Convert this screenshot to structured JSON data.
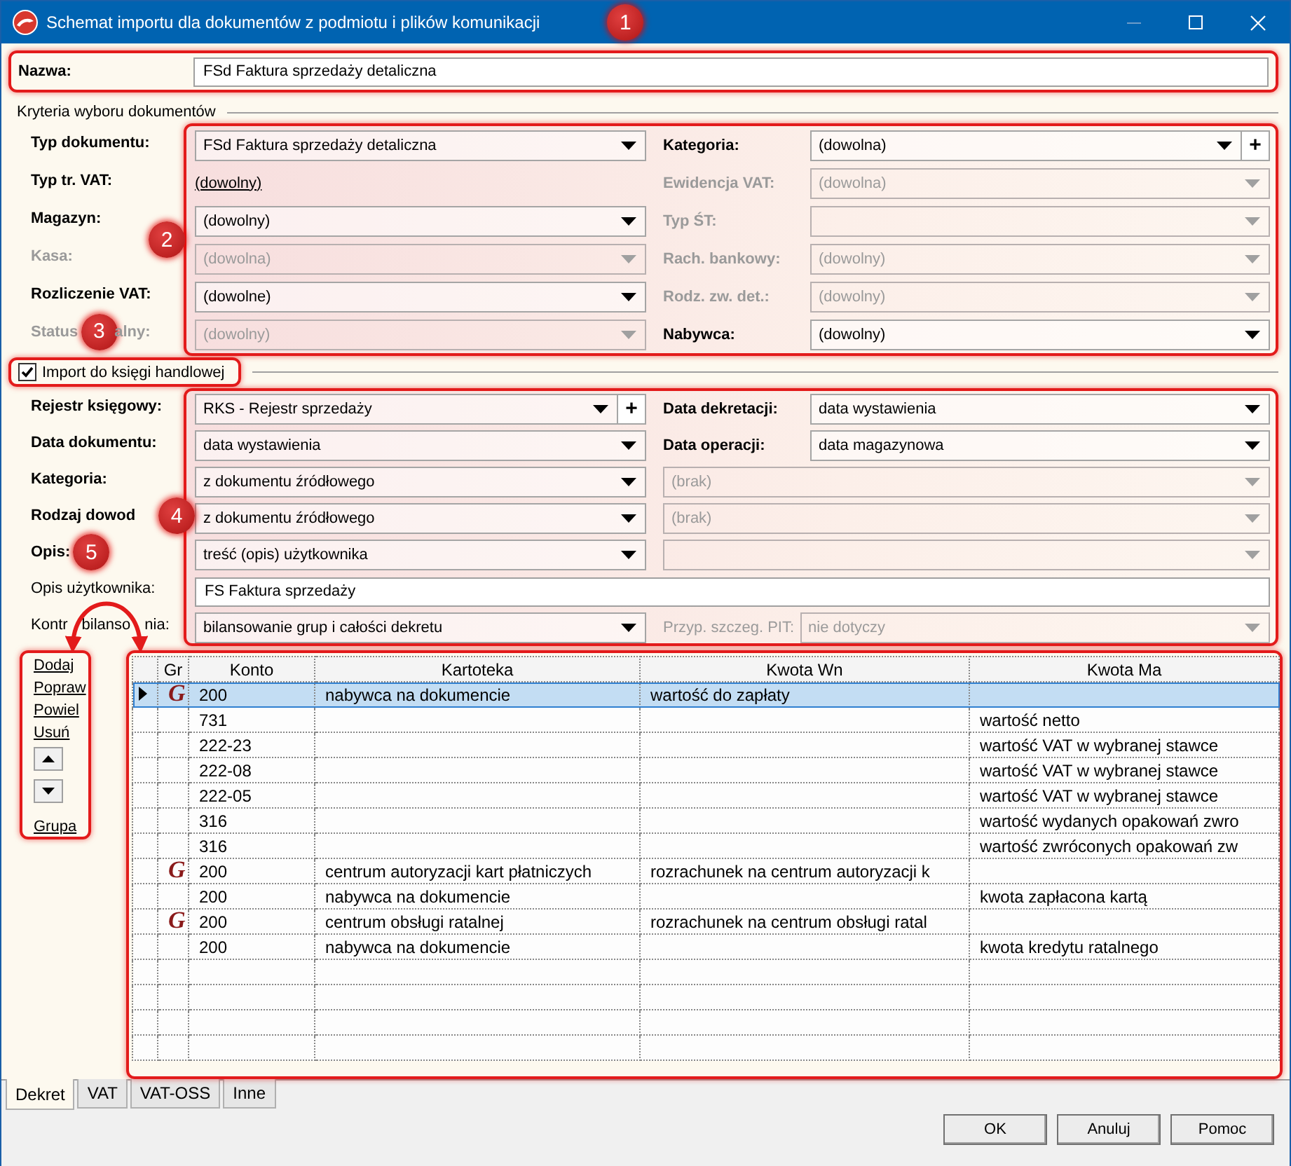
{
  "window": {
    "title": "Schemat importu dla dokumentów z podmiotu i plików komunikacji",
    "marker": "1"
  },
  "name_field": {
    "label": "Nazwa:",
    "value": "FSd Faktura sprzedaży detaliczna"
  },
  "criteria": {
    "title": "Kryteria wyboru dokumentów",
    "marker": "2",
    "rows": [
      {
        "label": "Typ dokumentu:",
        "bold": true,
        "disabled": false,
        "field": {
          "kind": "combo",
          "value": "FSd Faktura sprzedaży detaliczna",
          "disabled": false
        },
        "right": {
          "label": "Kategoria:",
          "bold": true,
          "disabled": false,
          "field": {
            "kind": "combo",
            "value": "(dowolna)",
            "disabled": false,
            "add_button": "+"
          }
        }
      },
      {
        "label": "Typ tr. VAT:",
        "bold": true,
        "disabled": false,
        "field": {
          "kind": "link",
          "value": "(dowolny)"
        },
        "right": {
          "label": "Ewidencja VAT:",
          "bold": true,
          "disabled": true,
          "field": {
            "kind": "combo",
            "value": "(dowolna)",
            "disabled": true
          }
        }
      },
      {
        "label": "Magazyn:",
        "bold": true,
        "disabled": false,
        "field": {
          "kind": "combo",
          "value": "(dowolny)",
          "disabled": false
        },
        "right": {
          "label": "Typ ŚT:",
          "bold": true,
          "disabled": true,
          "field": {
            "kind": "combo",
            "disabled": true
          }
        }
      },
      {
        "label": "Kasa:",
        "bold": true,
        "disabled": true,
        "field": {
          "kind": "combo",
          "value": "(dowolna)",
          "disabled": true
        },
        "right": {
          "label": "Rach. bankowy:",
          "bold": true,
          "disabled": true,
          "field": {
            "kind": "combo",
            "value": "(dowolny)",
            "disabled": true
          }
        }
      },
      {
        "label": "Rozliczenie VAT:",
        "bold": true,
        "disabled": false,
        "field": {
          "kind": "combo",
          "value": "(dowolne)",
          "disabled": false
        },
        "right": {
          "label": "Rodz. zw. det.:",
          "bold": true,
          "disabled": true,
          "field": {
            "kind": "combo",
            "value": "(dowolny)",
            "disabled": true
          }
        }
      },
      {
        "label": "Status",
        "marker": "3",
        "label_rest": [
          "alny:"
        ],
        "bold": true,
        "disabled": true,
        "field": {
          "kind": "combo",
          "value": "(dowolny)",
          "disabled": true
        },
        "right": {
          "label": "Nabywca:",
          "bold": true,
          "disabled": false,
          "field": {
            "kind": "combo",
            "value": "(dowolny)",
            "disabled": false
          }
        }
      }
    ]
  },
  "import": {
    "label": "Import do księgi handlowej",
    "checked": true
  },
  "posting": {
    "marker": "4",
    "rows": [
      {
        "label": "Rejestr księgowy:",
        "bold": true,
        "disabled": false,
        "field": {
          "kind": "combo",
          "value": "RKS - Rejestr sprzedaży",
          "disabled": false,
          "add_button": "+"
        },
        "right": {
          "label": "Data dekretacji:",
          "bold": true,
          "disabled": false,
          "field": {
            "kind": "combo",
            "value": "data wystawienia",
            "disabled": false
          }
        }
      },
      {
        "label": "Data dokumentu:",
        "bold": true,
        "disabled": false,
        "field": {
          "kind": "combo",
          "value": "data wystawienia",
          "disabled": false
        },
        "right": {
          "label": "Data operacji:",
          "bold": true,
          "disabled": false,
          "field": {
            "kind": "combo",
            "value": "data magazynowa",
            "disabled": false
          }
        }
      },
      {
        "label": "Kategoria:",
        "bold": true,
        "disabled": false,
        "field": {
          "kind": "combo",
          "value": "z dokumentu źródłowego",
          "disabled": false
        },
        "right": {
          "field": {
            "kind": "combo",
            "value": "(brak)",
            "disabled": true
          }
        }
      },
      {
        "label": "Rodzaj dowod",
        "bold": true,
        "disabled": false,
        "field": {
          "kind": "combo",
          "value": "z dokumentu źródłowego",
          "disabled": false
        },
        "right": {
          "field": {
            "kind": "combo",
            "value": "(brak)",
            "disabled": true
          }
        }
      },
      {
        "label": "Opis:",
        "marker": "5",
        "bold": true,
        "disabled": false,
        "field": {
          "kind": "combo",
          "value": "treść (opis) użytkownika",
          "disabled": false
        },
        "right": {
          "field": {
            "kind": "combo",
            "disabled": true
          }
        }
      },
      {
        "label": "Opis użytkownika:",
        "bold": false,
        "disabled": false,
        "field": {
          "kind": "text",
          "value": "FS Faktura sprzedaży"
        }
      },
      {
        "label": "Kontr",
        "label_rest": [
          "bilanso",
          "nia:"
        ],
        "bold": false,
        "disabled": false,
        "field": {
          "kind": "combo",
          "value": "bilansowanie grup i całości dekretu",
          "disabled": false
        },
        "right": {
          "label": "Przyp. szczeg. PIT:",
          "bold": false,
          "disabled": true,
          "field": {
            "kind": "combo",
            "value": "nie dotyczy",
            "disabled": true
          }
        }
      }
    ]
  },
  "actions": [
    {
      "kind": "link",
      "label": "Dodaj"
    },
    {
      "kind": "link",
      "label": "Popraw"
    },
    {
      "kind": "link",
      "label": "Powiel"
    },
    {
      "kind": "link",
      "label": "Usuń"
    },
    {
      "kind": "up"
    },
    {
      "kind": "down"
    },
    {
      "kind": "link",
      "label": "Grupa"
    }
  ],
  "table": {
    "columns": [
      "Gr",
      "Konto",
      "Kartoteka",
      "Kwota Wn",
      "Kwota Ma"
    ],
    "rows": [
      {
        "selected": true,
        "gr": "G",
        "konto": "200",
        "kartoteka": "nabywca na dokumencie",
        "kwota_wn": "wartość do zapłaty"
      },
      {
        "selected": false,
        "konto": "731",
        "kwota_ma": "wartość netto"
      },
      {
        "selected": false,
        "konto": "222-23",
        "kwota_ma": "wartość VAT w wybranej stawce"
      },
      {
        "selected": false,
        "konto": "222-08",
        "kwota_ma": "wartość VAT w wybranej stawce"
      },
      {
        "selected": false,
        "konto": "222-05",
        "kwota_ma": "wartość VAT w wybranej stawce"
      },
      {
        "selected": false,
        "konto": "316",
        "kwota_ma": "wartość wydanych opakowań zwro"
      },
      {
        "selected": false,
        "konto": "316",
        "kwota_ma": "wartość zwróconych opakowań zw"
      },
      {
        "selected": false,
        "gr": "G",
        "konto": "200",
        "kartoteka": "centrum autoryzacji kart płatniczych",
        "kwota_wn": "rozrachunek na centrum autoryzacji k"
      },
      {
        "selected": false,
        "konto": "200",
        "kartoteka": "nabywca na dokumencie",
        "kwota_ma": "kwota zapłacona kartą"
      },
      {
        "selected": false,
        "gr": "G",
        "konto": "200",
        "kartoteka": "centrum obsługi ratalnej",
        "kwota_wn": "rozrachunek na centrum obsługi ratal"
      },
      {
        "selected": false,
        "konto": "200",
        "kartoteka": "nabywca na dokumencie",
        "kwota_ma": "kwota kredytu ratalnego"
      }
    ]
  },
  "tabs": [
    {
      "label": "Dekret",
      "selected": true
    },
    {
      "label": "VAT",
      "selected": false
    },
    {
      "label": "VAT-OSS",
      "selected": false
    },
    {
      "label": "Inne",
      "selected": false
    }
  ],
  "buttons": [
    "OK",
    "Anuluj",
    "Pomoc"
  ]
}
